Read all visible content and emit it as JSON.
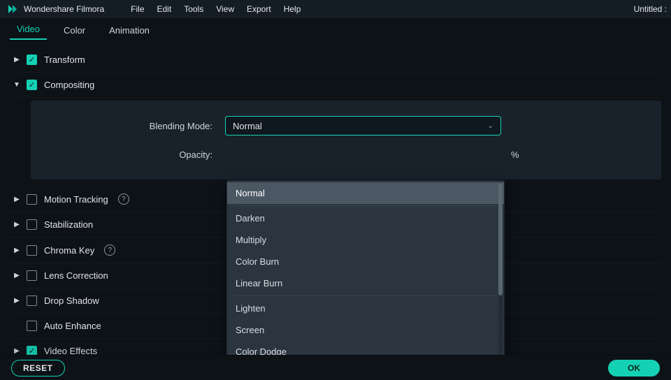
{
  "app": {
    "name": "Wondershare Filmora",
    "doc_title": "Untitled :"
  },
  "menu": {
    "items": [
      "File",
      "Edit",
      "Tools",
      "View",
      "Export",
      "Help"
    ]
  },
  "tabs": {
    "items": [
      "Video",
      "Color",
      "Animation"
    ],
    "active": 0
  },
  "sections": {
    "transform": {
      "label": "Transform",
      "checked": true,
      "expanded": false,
      "help": false
    },
    "compositing": {
      "label": "Compositing",
      "checked": true,
      "expanded": true,
      "help": false
    },
    "motion_tracking": {
      "label": "Motion Tracking",
      "checked": false,
      "expanded": false,
      "help": true
    },
    "stabilization": {
      "label": "Stabilization",
      "checked": false,
      "expanded": false,
      "help": false
    },
    "chroma_key": {
      "label": "Chroma Key",
      "checked": false,
      "expanded": false,
      "help": true
    },
    "lens_correction": {
      "label": "Lens Correction",
      "checked": false,
      "expanded": false,
      "help": false
    },
    "drop_shadow": {
      "label": "Drop Shadow",
      "checked": false,
      "expanded": false,
      "help": false
    },
    "auto_enhance": {
      "label": "Auto Enhance",
      "checked": false,
      "expanded": false,
      "help": false
    },
    "video_effects": {
      "label": "Video Effects",
      "checked": true,
      "expanded": false,
      "help": false
    }
  },
  "compositing": {
    "blend_label": "Blending Mode:",
    "blend_value": "Normal",
    "opacity_label": "Opacity:",
    "opacity_unit": "%",
    "blend_options": [
      "Normal",
      "",
      "Darken",
      "Multiply",
      "Color Burn",
      "Linear Burn",
      "",
      "Lighten",
      "Screen",
      "Color Dodge"
    ]
  },
  "footer": {
    "reset": "RESET",
    "ok": "OK"
  }
}
